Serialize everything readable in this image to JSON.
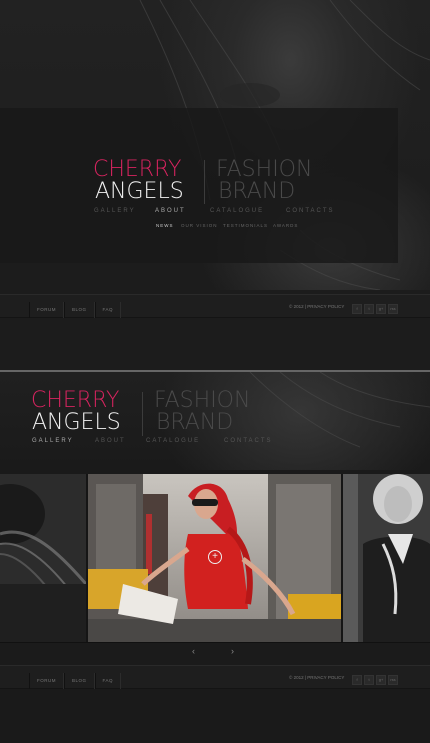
{
  "brand": {
    "cherry": "CHERRY",
    "angels": "ANGELS",
    "fashion": "FASHION",
    "brand_word": "BRAND"
  },
  "top": {
    "nav": [
      "GALLERY",
      "ABOUT",
      "CATALOGUE",
      "CONTACTS"
    ],
    "active_nav": "ABOUT",
    "subnav": [
      "NEWS",
      "OUR VISION",
      "TESTIMONIALS",
      "AWARDS"
    ],
    "active_subnav": "NEWS"
  },
  "footer": {
    "links": [
      "FORUM",
      "BLOG",
      "FAQ"
    ],
    "copyright": "© 2012 | PRIVACY POLICY",
    "social": [
      "f",
      "t",
      "g+",
      "rss"
    ]
  },
  "bottom": {
    "nav": [
      "GALLERY",
      "ABOUT",
      "CATALOGUE",
      "CONTACTS"
    ],
    "active_nav": "GALLERY",
    "gallery_prev": "‹",
    "gallery_next": "›"
  },
  "colors": {
    "accent": "#d6245f",
    "background": "#1a1a1a"
  },
  "icons": {
    "zoom": "plus-circle-icon",
    "prev": "chevron-left-icon",
    "next": "chevron-right-icon"
  }
}
